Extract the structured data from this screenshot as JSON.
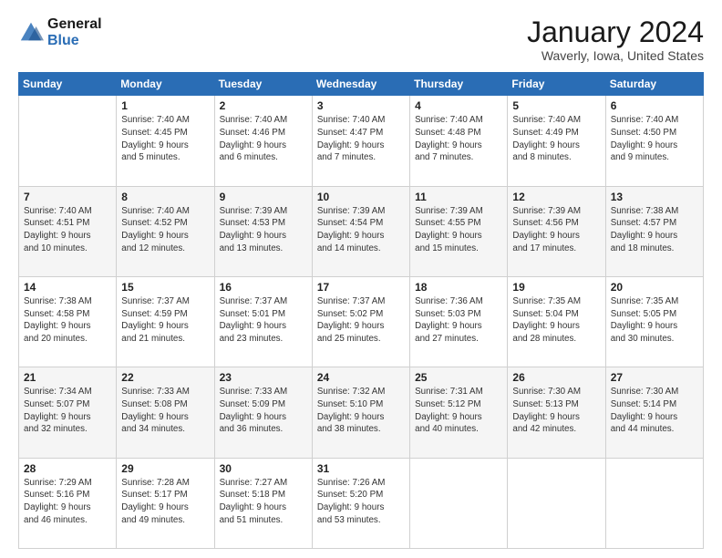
{
  "logo": {
    "text_general": "General",
    "text_blue": "Blue"
  },
  "header": {
    "title": "January 2024",
    "subtitle": "Waverly, Iowa, United States"
  },
  "weekdays": [
    "Sunday",
    "Monday",
    "Tuesday",
    "Wednesday",
    "Thursday",
    "Friday",
    "Saturday"
  ],
  "weeks": [
    [
      {
        "day": "",
        "info": ""
      },
      {
        "day": "1",
        "info": "Sunrise: 7:40 AM\nSunset: 4:45 PM\nDaylight: 9 hours\nand 5 minutes."
      },
      {
        "day": "2",
        "info": "Sunrise: 7:40 AM\nSunset: 4:46 PM\nDaylight: 9 hours\nand 6 minutes."
      },
      {
        "day": "3",
        "info": "Sunrise: 7:40 AM\nSunset: 4:47 PM\nDaylight: 9 hours\nand 7 minutes."
      },
      {
        "day": "4",
        "info": "Sunrise: 7:40 AM\nSunset: 4:48 PM\nDaylight: 9 hours\nand 7 minutes."
      },
      {
        "day": "5",
        "info": "Sunrise: 7:40 AM\nSunset: 4:49 PM\nDaylight: 9 hours\nand 8 minutes."
      },
      {
        "day": "6",
        "info": "Sunrise: 7:40 AM\nSunset: 4:50 PM\nDaylight: 9 hours\nand 9 minutes."
      }
    ],
    [
      {
        "day": "7",
        "info": "Sunrise: 7:40 AM\nSunset: 4:51 PM\nDaylight: 9 hours\nand 10 minutes."
      },
      {
        "day": "8",
        "info": "Sunrise: 7:40 AM\nSunset: 4:52 PM\nDaylight: 9 hours\nand 12 minutes."
      },
      {
        "day": "9",
        "info": "Sunrise: 7:39 AM\nSunset: 4:53 PM\nDaylight: 9 hours\nand 13 minutes."
      },
      {
        "day": "10",
        "info": "Sunrise: 7:39 AM\nSunset: 4:54 PM\nDaylight: 9 hours\nand 14 minutes."
      },
      {
        "day": "11",
        "info": "Sunrise: 7:39 AM\nSunset: 4:55 PM\nDaylight: 9 hours\nand 15 minutes."
      },
      {
        "day": "12",
        "info": "Sunrise: 7:39 AM\nSunset: 4:56 PM\nDaylight: 9 hours\nand 17 minutes."
      },
      {
        "day": "13",
        "info": "Sunrise: 7:38 AM\nSunset: 4:57 PM\nDaylight: 9 hours\nand 18 minutes."
      }
    ],
    [
      {
        "day": "14",
        "info": "Sunrise: 7:38 AM\nSunset: 4:58 PM\nDaylight: 9 hours\nand 20 minutes."
      },
      {
        "day": "15",
        "info": "Sunrise: 7:37 AM\nSunset: 4:59 PM\nDaylight: 9 hours\nand 21 minutes."
      },
      {
        "day": "16",
        "info": "Sunrise: 7:37 AM\nSunset: 5:01 PM\nDaylight: 9 hours\nand 23 minutes."
      },
      {
        "day": "17",
        "info": "Sunrise: 7:37 AM\nSunset: 5:02 PM\nDaylight: 9 hours\nand 25 minutes."
      },
      {
        "day": "18",
        "info": "Sunrise: 7:36 AM\nSunset: 5:03 PM\nDaylight: 9 hours\nand 27 minutes."
      },
      {
        "day": "19",
        "info": "Sunrise: 7:35 AM\nSunset: 5:04 PM\nDaylight: 9 hours\nand 28 minutes."
      },
      {
        "day": "20",
        "info": "Sunrise: 7:35 AM\nSunset: 5:05 PM\nDaylight: 9 hours\nand 30 minutes."
      }
    ],
    [
      {
        "day": "21",
        "info": "Sunrise: 7:34 AM\nSunset: 5:07 PM\nDaylight: 9 hours\nand 32 minutes."
      },
      {
        "day": "22",
        "info": "Sunrise: 7:33 AM\nSunset: 5:08 PM\nDaylight: 9 hours\nand 34 minutes."
      },
      {
        "day": "23",
        "info": "Sunrise: 7:33 AM\nSunset: 5:09 PM\nDaylight: 9 hours\nand 36 minutes."
      },
      {
        "day": "24",
        "info": "Sunrise: 7:32 AM\nSunset: 5:10 PM\nDaylight: 9 hours\nand 38 minutes."
      },
      {
        "day": "25",
        "info": "Sunrise: 7:31 AM\nSunset: 5:12 PM\nDaylight: 9 hours\nand 40 minutes."
      },
      {
        "day": "26",
        "info": "Sunrise: 7:30 AM\nSunset: 5:13 PM\nDaylight: 9 hours\nand 42 minutes."
      },
      {
        "day": "27",
        "info": "Sunrise: 7:30 AM\nSunset: 5:14 PM\nDaylight: 9 hours\nand 44 minutes."
      }
    ],
    [
      {
        "day": "28",
        "info": "Sunrise: 7:29 AM\nSunset: 5:16 PM\nDaylight: 9 hours\nand 46 minutes."
      },
      {
        "day": "29",
        "info": "Sunrise: 7:28 AM\nSunset: 5:17 PM\nDaylight: 9 hours\nand 49 minutes."
      },
      {
        "day": "30",
        "info": "Sunrise: 7:27 AM\nSunset: 5:18 PM\nDaylight: 9 hours\nand 51 minutes."
      },
      {
        "day": "31",
        "info": "Sunrise: 7:26 AM\nSunset: 5:20 PM\nDaylight: 9 hours\nand 53 minutes."
      },
      {
        "day": "",
        "info": ""
      },
      {
        "day": "",
        "info": ""
      },
      {
        "day": "",
        "info": ""
      }
    ]
  ]
}
